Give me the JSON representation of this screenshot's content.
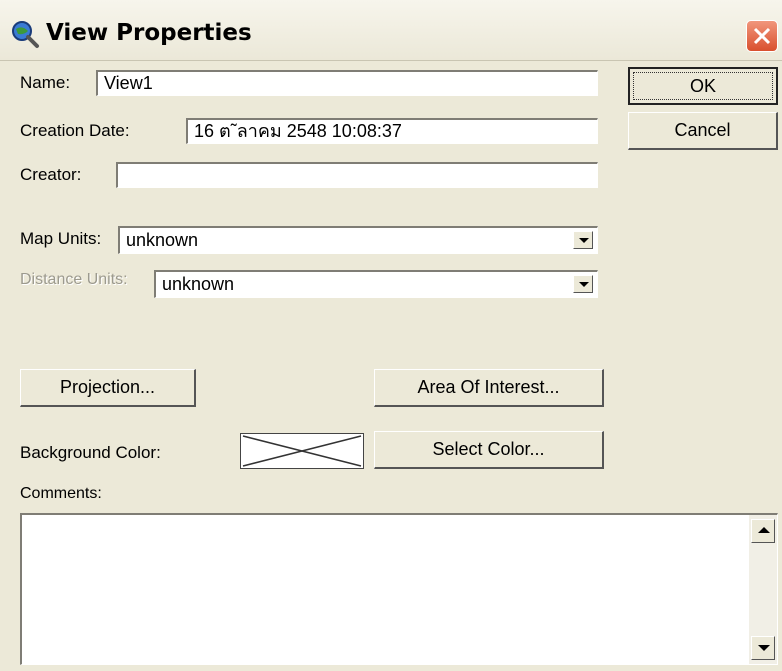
{
  "window": {
    "title": "View Properties",
    "icon": "magnifier-globe-icon"
  },
  "fields": {
    "name_label": "Name:",
    "name_value": "View1",
    "creation_date_label": "Creation Date:",
    "creation_date_value": "16 ต˜ลาคม 2548 10:08:37",
    "creator_label": "Creator:",
    "creator_value": "",
    "map_units_label": "Map Units:",
    "map_units_value": "unknown",
    "distance_units_label": "Distance Units:",
    "distance_units_value": "unknown",
    "background_color_label": "Background Color:",
    "comments_label": "Comments:",
    "comments_value": ""
  },
  "buttons": {
    "ok": "OK",
    "cancel": "Cancel",
    "projection": "Projection...",
    "area_of_interest": "Area Of Interest...",
    "select_color": "Select Color..."
  },
  "colors": {
    "title_text": "#000000",
    "dialog_bg": "#ece9d8",
    "close_button": "#d9502e"
  }
}
